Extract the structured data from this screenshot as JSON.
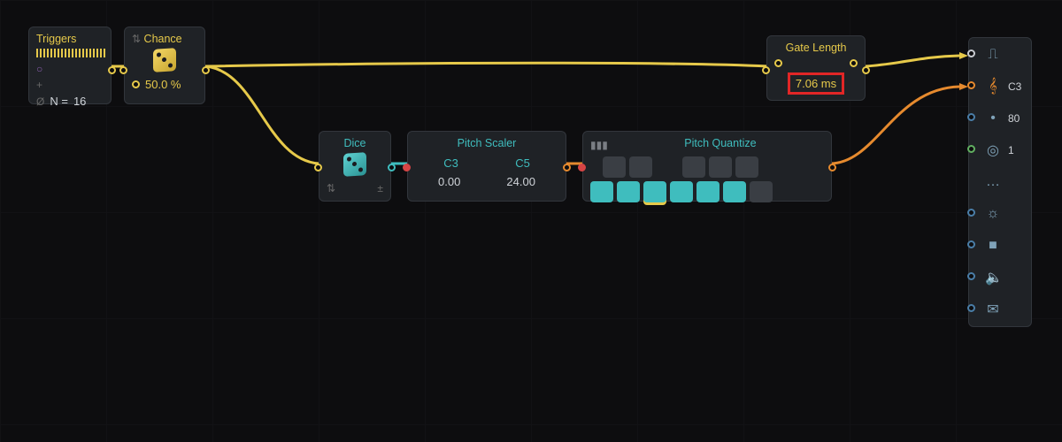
{
  "nodes": {
    "triggers": {
      "title": "Triggers",
      "n_label": "N =",
      "n_value": "16"
    },
    "chance": {
      "title": "Chance",
      "value": "50.0 %"
    },
    "dice": {
      "title": "Dice"
    },
    "scaler": {
      "title": "Pitch Scaler",
      "low_note": "C3",
      "high_note": "C5",
      "low_val": "0.00",
      "high_val": "24.00"
    },
    "quantize": {
      "title": "Pitch Quantize",
      "black_keys": [
        false,
        false,
        false,
        false,
        false
      ],
      "white_keys": [
        true,
        true,
        true,
        true,
        true,
        true,
        false
      ]
    },
    "gate": {
      "title": "Gate Length",
      "value": "7.06 ms"
    }
  },
  "rail": [
    {
      "name": "gate-out",
      "glyph": "⎍",
      "value": "",
      "port": "wh"
    },
    {
      "name": "pitch-out",
      "glyph": "𝄞",
      "value": "C3",
      "port": "or",
      "glyphClass": "or"
    },
    {
      "name": "velocity-out",
      "glyph": "•",
      "value": "80",
      "port": "bl"
    },
    {
      "name": "mod-out",
      "glyph": "◎",
      "value": "1",
      "port": "gr"
    },
    {
      "name": "misc",
      "glyph": "…",
      "value": "",
      "port": ""
    },
    {
      "name": "brightness",
      "glyph": "☼",
      "value": "",
      "port": "bl"
    },
    {
      "name": "case",
      "glyph": "■",
      "value": "",
      "port": "bl"
    },
    {
      "name": "mute",
      "glyph": "🔈",
      "value": "",
      "port": "bl"
    },
    {
      "name": "envelope",
      "glyph": "✉",
      "value": "",
      "port": "bl"
    }
  ]
}
